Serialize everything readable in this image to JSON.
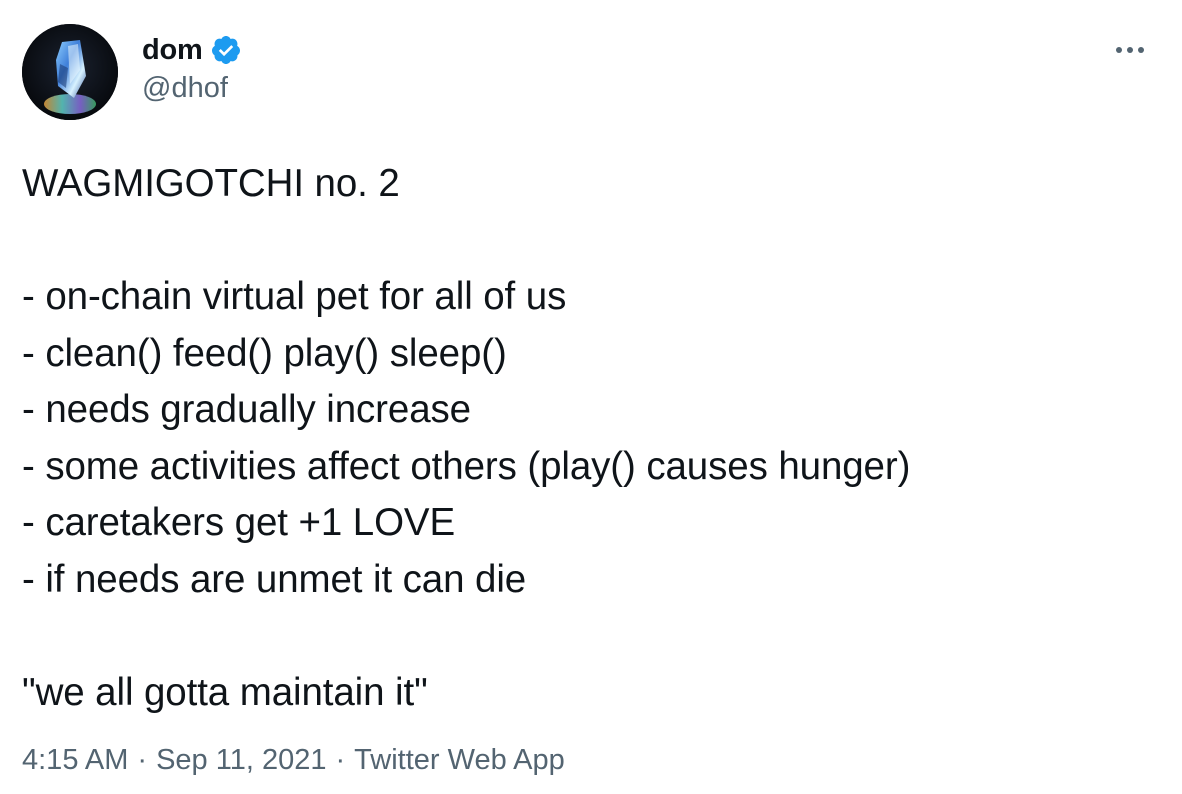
{
  "author": {
    "display_name": "dom",
    "handle": "@dhof",
    "verified": true
  },
  "icons": {
    "verified": "verified-badge-icon",
    "more": "more-horizontal-icon"
  },
  "tweet": {
    "lines": [
      "WAGMIGOTCHI no. 2",
      "",
      "- on-chain virtual pet for all of us",
      "- clean() feed() play() sleep()",
      "- needs gradually increase",
      "- some activities affect others (play() causes hunger)",
      "- caretakers get +1 LOVE",
      "- if needs are unmet it can die",
      "",
      "\"we all gotta maintain it\""
    ]
  },
  "meta": {
    "time": "4:15 AM",
    "separator": "·",
    "date": "Sep 11, 2021",
    "source": "Twitter Web App"
  },
  "colors": {
    "text": "#0f1419",
    "secondary": "#536471",
    "verified_blue": "#1d9bf0"
  }
}
